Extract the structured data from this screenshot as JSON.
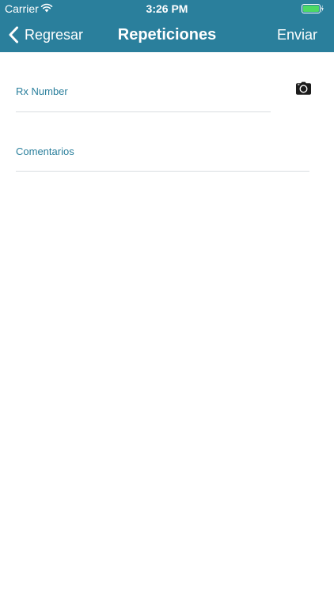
{
  "status_bar": {
    "carrier": "Carrier",
    "time": "3:26 PM",
    "wifi_icon": "wifi-icon",
    "battery_icon": "battery-charging-icon"
  },
  "nav": {
    "back_label": "Regresar",
    "title": "Repeticiones",
    "send_label": "Enviar"
  },
  "form": {
    "rx_number": {
      "placeholder": "Rx Number",
      "value": ""
    },
    "comments": {
      "placeholder": "Comentarios",
      "value": ""
    },
    "camera_icon": "camera-icon"
  },
  "colors": {
    "header_background": "#2a7f9c",
    "accent_text": "#2a7f9c",
    "divider": "#d9dde0",
    "battery_green": "#4cd964"
  }
}
